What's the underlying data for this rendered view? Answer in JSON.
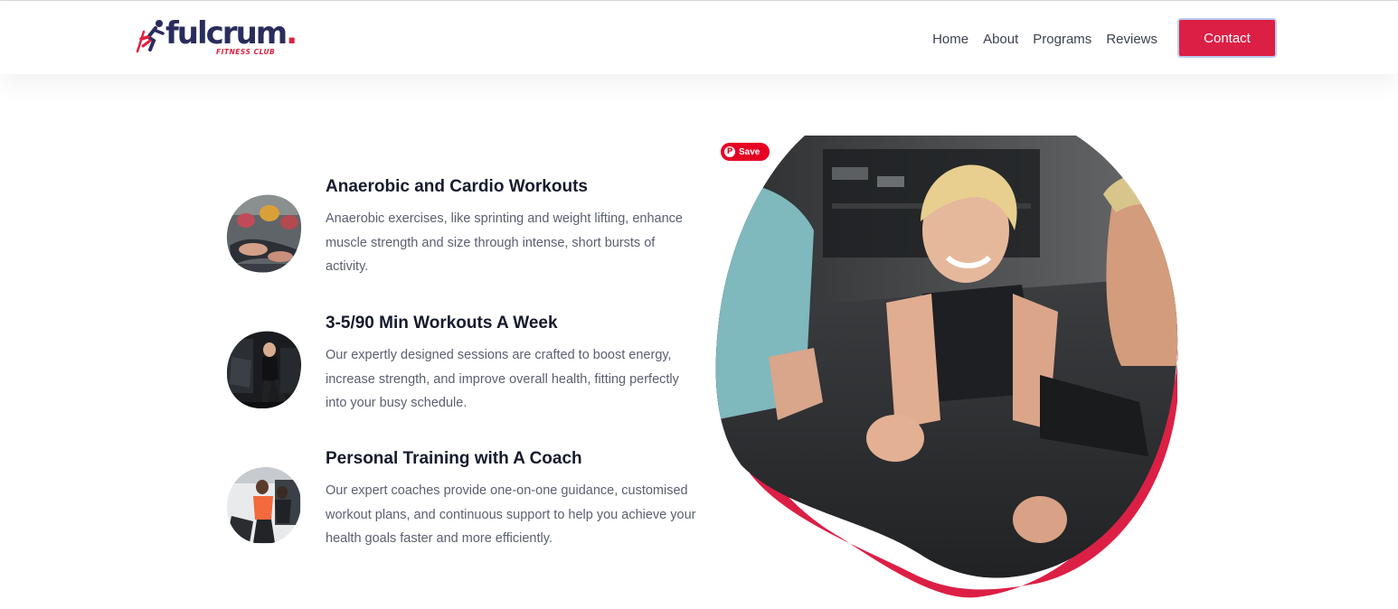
{
  "brand": {
    "name": "fulcrum",
    "dot": ".",
    "tagline": "FITNESS CLUB"
  },
  "nav": {
    "items": [
      "Home",
      "About",
      "Programs",
      "Reviews"
    ],
    "contact_label": "Contact"
  },
  "features": [
    {
      "title": "Anaerobic and Cardio Workouts",
      "description": "Anaerobic exercises, like sprinting and weight lifting, enhance muscle strength and size through intense, short bursts of activity."
    },
    {
      "title": "3-5/90 Min Workouts A Week",
      "description": "Our expertly designed sessions are crafted to boost energy, increase strength, and improve overall health, fitting perfectly into your busy schedule."
    },
    {
      "title": "Personal Training with A Coach",
      "description": "Our expert coaches provide one-on-one guidance, customised workout plans, and continuous support to help you achieve your health goals faster and more efficiently."
    }
  ],
  "pin": {
    "label": "Save",
    "icon": "pinterest-icon"
  },
  "colors": {
    "accent": "#dc1f45",
    "brand_navy": "#2a2d5c",
    "heading": "#151a2d",
    "body_text": "#5b6070"
  }
}
